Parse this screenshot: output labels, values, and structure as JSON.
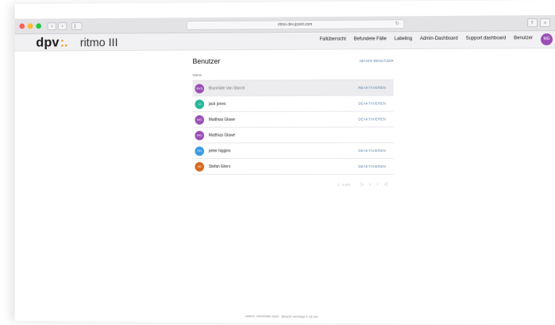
{
  "browser": {
    "url": "ritmo-dev.ipoint.com",
    "nav_back": "‹",
    "nav_forward": "›",
    "reload": "↻",
    "share": "⇧",
    "search": "⌕"
  },
  "app": {
    "logo": "dpv",
    "logo_dots": ":.",
    "title": "ritmo III"
  },
  "topnav": {
    "items": [
      {
        "label": "Fallübersicht"
      },
      {
        "label": "Befundete Fälle"
      },
      {
        "label": "Labeling"
      },
      {
        "label": "Admin-Dashboard"
      },
      {
        "label": "Support dashboard"
      },
      {
        "label": "Benutzer"
      }
    ],
    "avatar": "MG"
  },
  "page": {
    "title": "Benutzer",
    "new_user": "NEUER BENUTZER",
    "column_name": "Name"
  },
  "users": [
    {
      "initials": "BVS",
      "name": "Brunhilde Van Storch",
      "action": "REAKTIVIEREN",
      "color": "#9b4fb6"
    },
    {
      "initials": "JJ",
      "name": "jack jones",
      "action": "DEAKTIVIEREN",
      "color": "#27b59b"
    },
    {
      "initials": "MG",
      "name": "Matthias Glawe",
      "action": "DEAKTIVIEREN",
      "color": "#9b4fb6"
    },
    {
      "initials": "MG",
      "name": "Matthias Glawe",
      "action": "",
      "color": "#9b4fb6"
    },
    {
      "initials": "PH",
      "name": "peter higgins",
      "action": "DEAKTIVIEREN",
      "color": "#3b9be0"
    },
    {
      "initials": "SE",
      "name": "Stefan Eilers",
      "action": "DEAKTIVIEREN",
      "color": "#d4691e"
    }
  ],
  "pagination": {
    "range": "1 – 6 of 6",
    "first": "|‹",
    "prev": "‹",
    "next": "›",
    "last": "›|"
  },
  "footer": {
    "text": "Hotline: 040/53462-9309 · Besetzt werktags 9-16 Uhr"
  }
}
